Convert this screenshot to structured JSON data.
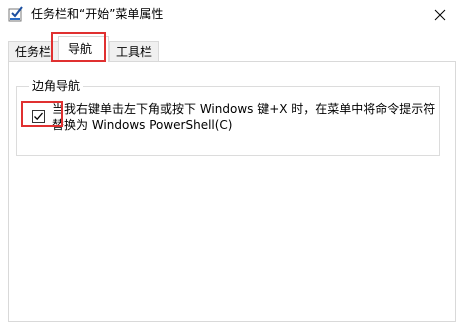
{
  "window": {
    "title": "任务栏和“开始”菜单属性"
  },
  "tabs": [
    {
      "label": "任务栏"
    },
    {
      "label": "导航"
    },
    {
      "label": "工具栏"
    }
  ],
  "group": {
    "title": "边角导航",
    "checkbox": {
      "checked": true,
      "label_line1": "当我右键单击左下角或按下 Windows 键+X 时，在菜单中将命令提示符",
      "label_line2": "替换为 Windows PowerShell(C)"
    }
  },
  "colors": {
    "highlight": "#e03030",
    "border": "#d9d9d9"
  }
}
